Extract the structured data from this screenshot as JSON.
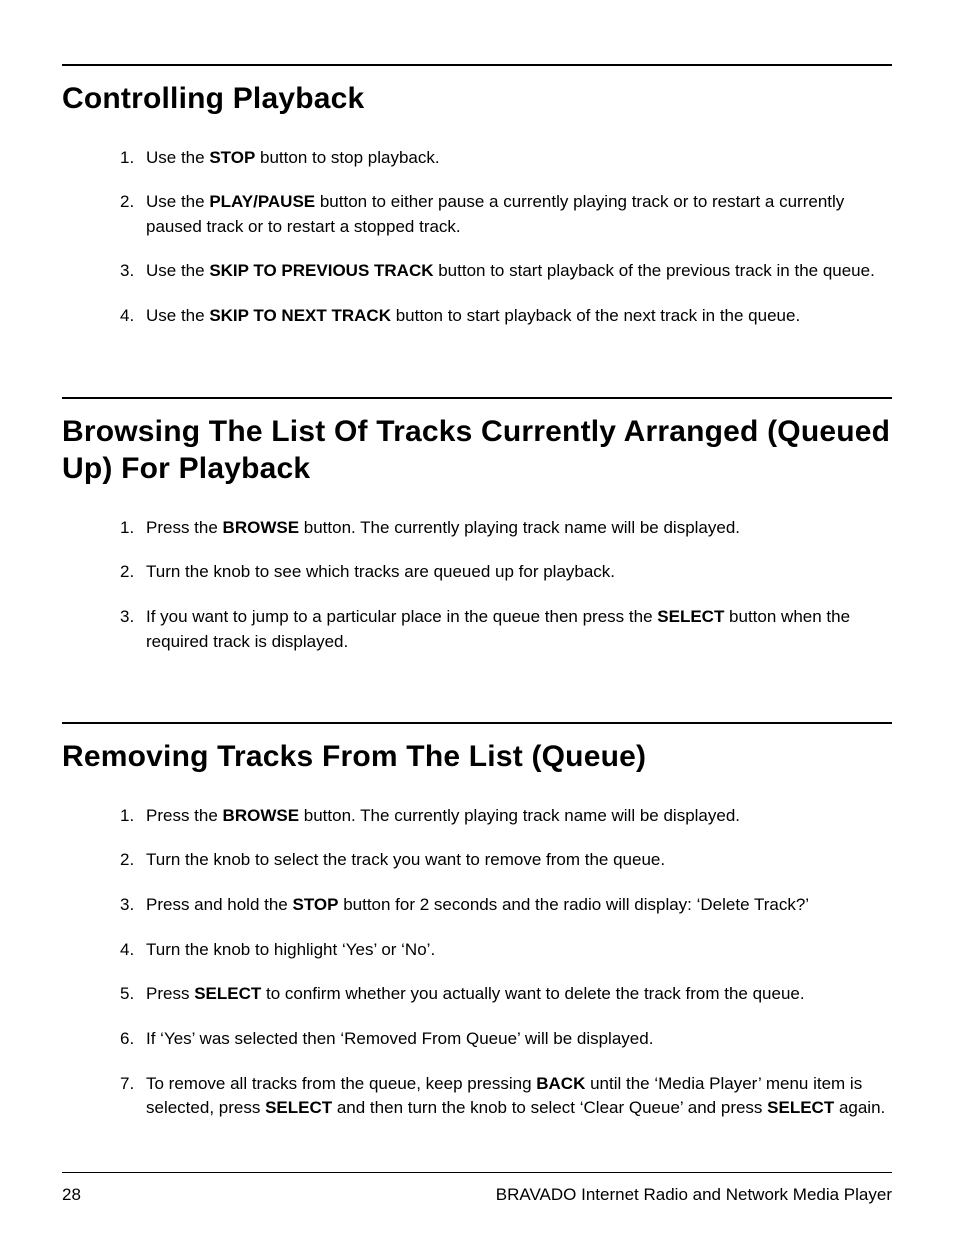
{
  "sections": [
    {
      "heading": "Controlling Playback",
      "steps": [
        [
          {
            "t": "Use the "
          },
          {
            "t": "STOP",
            "b": true
          },
          {
            "t": " button to stop playback."
          }
        ],
        [
          {
            "t": "Use the "
          },
          {
            "t": "PLAY/PAUSE",
            "b": true
          },
          {
            "t": " button to either pause a currently playing track or to restart a currently paused track or to restart a stopped track."
          }
        ],
        [
          {
            "t": "Use the "
          },
          {
            "t": "SKIP TO PREVIOUS TRACK",
            "b": true
          },
          {
            "t": " button to start playback of the previous track in the queue."
          }
        ],
        [
          {
            "t": "Use the "
          },
          {
            "t": "SKIP TO NEXT TRACK",
            "b": true
          },
          {
            "t": " button to start playback of the next track in the queue."
          }
        ]
      ]
    },
    {
      "heading": "Browsing The List Of Tracks Currently Arranged (Queued Up)  For Playback",
      "steps": [
        [
          {
            "t": "Press the "
          },
          {
            "t": "BROWSE",
            "b": true
          },
          {
            "t": " button. The currently playing track name will be displayed."
          }
        ],
        [
          {
            "t": "Turn the knob to see which tracks are queued up for playback."
          }
        ],
        [
          {
            "t": "If you want to jump to a particular place in the queue then press the "
          },
          {
            "t": "SELECT",
            "b": true
          },
          {
            "t": " button when the required track is displayed."
          }
        ]
      ]
    },
    {
      "heading": "Removing Tracks From The List (Queue)",
      "steps": [
        [
          {
            "t": "Press the "
          },
          {
            "t": "BROWSE",
            "b": true
          },
          {
            "t": " button. The currently playing track name will be displayed."
          }
        ],
        [
          {
            "t": "Turn the knob to select the track you want to remove from the queue."
          }
        ],
        [
          {
            "t": "Press and hold the "
          },
          {
            "t": "STOP",
            "b": true
          },
          {
            "t": " button for 2 seconds and the radio will display: ‘Delete Track?’"
          }
        ],
        [
          {
            "t": "Turn the knob to highlight ‘Yes’ or ‘No’."
          }
        ],
        [
          {
            "t": "Press "
          },
          {
            "t": "SELECT",
            "b": true
          },
          {
            "t": " to confirm whether you actually want to delete the track from the queue."
          }
        ],
        [
          {
            "t": "If ‘Yes’ was selected then ‘Removed From Queue’ will be displayed."
          }
        ],
        [
          {
            "t": "To remove all tracks from the queue, keep pressing "
          },
          {
            "t": "BACK",
            "b": true
          },
          {
            "t": " until the ‘Media Player’ menu item is selected, press "
          },
          {
            "t": "SELECT",
            "b": true
          },
          {
            "t": " and then turn the knob to select ‘Clear Queue’ and press "
          },
          {
            "t": "SELECT",
            "b": true
          },
          {
            "t": " again."
          }
        ]
      ]
    }
  ],
  "footer": {
    "page_number": "28",
    "product": "BRAVADO Internet Radio and Network Media Player"
  }
}
